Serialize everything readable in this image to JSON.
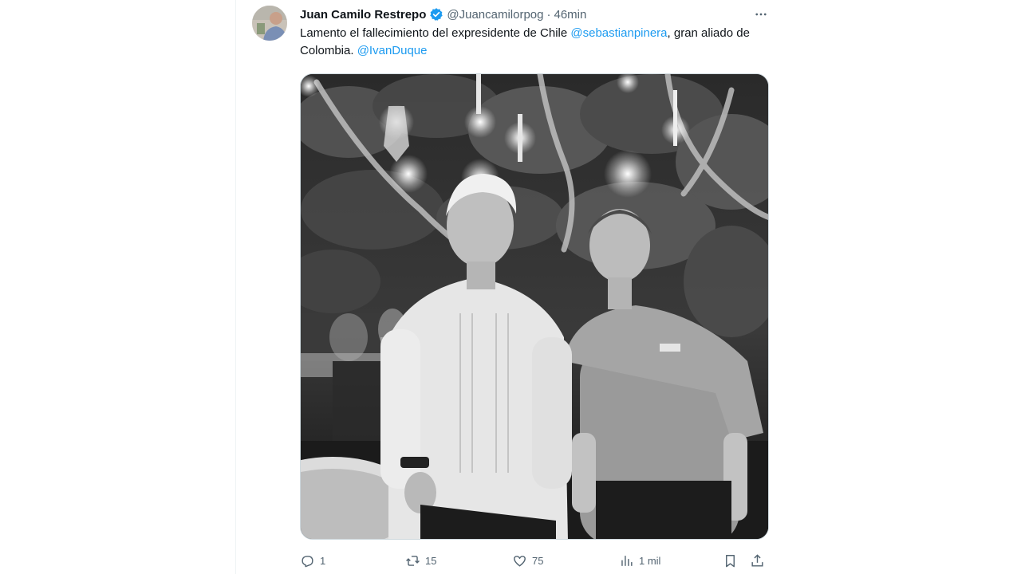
{
  "tweet": {
    "author_name": "Juan Camilo Restrepo",
    "handle": "@Juancamilorpog",
    "separator": "·",
    "time": "46min",
    "text_part1": "Lamento el fallecimiento del expresidente de Chile ",
    "mention1": "@sebastianpinera",
    "text_part2": ", gran aliado de Colombia. ",
    "mention2": "@IvanDuque",
    "verified_icon": "verified-badge-icon",
    "more_icon": "more-options-icon",
    "media_description_icon": "photo"
  },
  "actions": {
    "reply_count": "1",
    "retweet_count": "15",
    "like_count": "75",
    "views_count": "1 mil"
  },
  "colors": {
    "accent": "#1d9bf0",
    "text_primary": "#0f1419",
    "text_secondary": "#536471",
    "border": "#cfd9de"
  }
}
